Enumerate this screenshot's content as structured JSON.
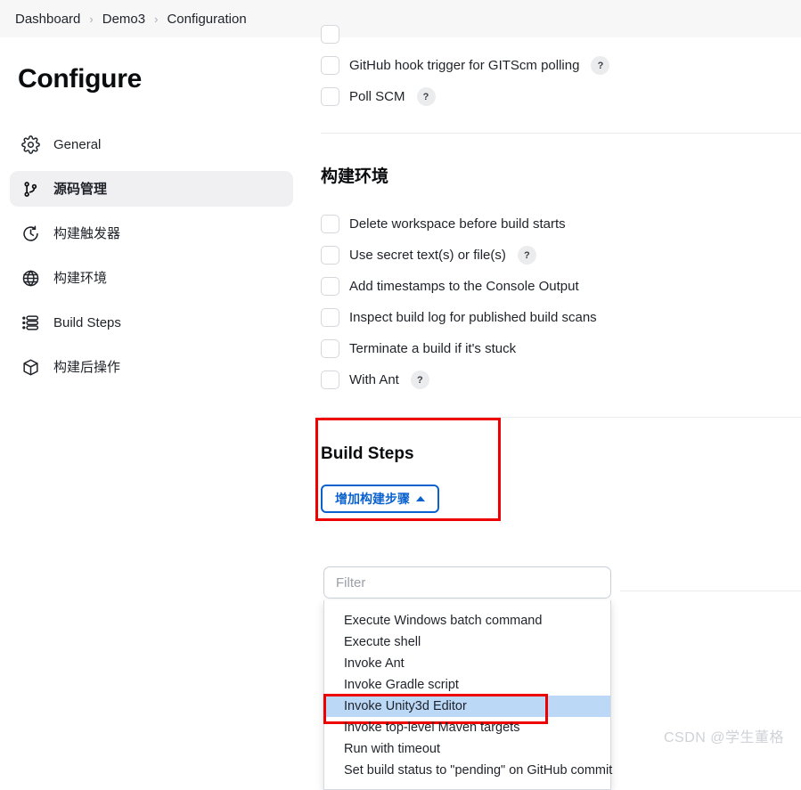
{
  "breadcrumb": {
    "items": [
      "Dashboard",
      "Demo3",
      "Configuration"
    ],
    "separator": "›"
  },
  "sidebar": {
    "title": "Configure",
    "items": [
      {
        "label": "General",
        "icon": "gear-icon",
        "active": false
      },
      {
        "label": "源码管理",
        "icon": "git-branch-icon",
        "active": true
      },
      {
        "label": "构建触发器",
        "icon": "clock-icon",
        "active": false
      },
      {
        "label": "构建环境",
        "icon": "globe-icon",
        "active": false
      },
      {
        "label": "Build Steps",
        "icon": "list-icon",
        "active": false
      },
      {
        "label": "构建后操作",
        "icon": "package-icon",
        "active": false
      }
    ]
  },
  "triggers": {
    "checkboxes": [
      {
        "label": "GitHub hook trigger for GITScm polling",
        "checked": false,
        "help": "?"
      },
      {
        "label": "Poll SCM",
        "checked": false,
        "help": "?"
      }
    ]
  },
  "build_environment": {
    "title": "构建环境",
    "checkboxes": [
      {
        "label": "Delete workspace before build starts",
        "checked": false,
        "help": ""
      },
      {
        "label": "Use secret text(s) or file(s)",
        "checked": false,
        "help": "?"
      },
      {
        "label": "Add timestamps to the Console Output",
        "checked": false,
        "help": ""
      },
      {
        "label": "Inspect build log for published build scans",
        "checked": false,
        "help": ""
      },
      {
        "label": "Terminate a build if it's stuck",
        "checked": false,
        "help": ""
      },
      {
        "label": "With Ant",
        "checked": false,
        "help": "?"
      }
    ]
  },
  "build_steps": {
    "title": "Build Steps",
    "add_button_label": "增加构建步骤",
    "add_button_caret": "▲",
    "filter_placeholder": "Filter",
    "filter_value": "",
    "options": [
      {
        "label": "Execute Windows batch command",
        "selected": false
      },
      {
        "label": "Execute shell",
        "selected": false
      },
      {
        "label": "Invoke Ant",
        "selected": false
      },
      {
        "label": "Invoke Gradle script",
        "selected": false
      },
      {
        "label": "Invoke Unity3d Editor",
        "selected": true
      },
      {
        "label": "Invoke top-level Maven targets",
        "selected": false
      },
      {
        "label": "Run with timeout",
        "selected": false
      },
      {
        "label": "Set build status to \"pending\" on GitHub commit",
        "selected": false
      }
    ]
  },
  "annotations": {
    "highlight_color": "#ee0000",
    "selected_row_color": "#bcd8f7",
    "accent_color": "#0b62cf"
  },
  "watermark": "CSDN @学生董格"
}
